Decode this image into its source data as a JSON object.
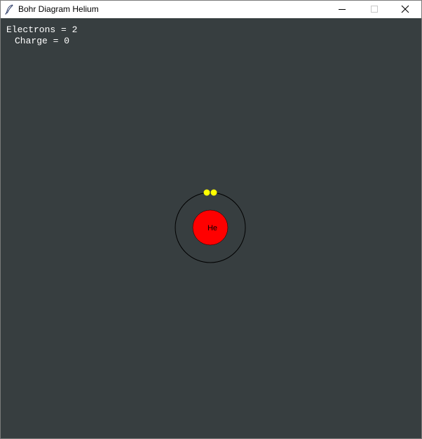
{
  "window": {
    "title": "Bohr Diagram Helium",
    "app_icon": "feather-icon",
    "controls": {
      "minimize_icon": "minimize-icon",
      "maximize_icon": "maximize-icon",
      "close_icon": "close-icon"
    }
  },
  "readout": {
    "electrons_text": "Electrons = 2",
    "charge_text": "Charge = 0",
    "text_color": "#ffffff"
  },
  "atom": {
    "symbol": "He",
    "electrons": 2,
    "shells": [
      2
    ],
    "colors": {
      "background": "#373e40",
      "nucleus": "#ff0000",
      "electron": "#ffff00",
      "shell": "#000000",
      "symbol_text": "#000000"
    }
  }
}
